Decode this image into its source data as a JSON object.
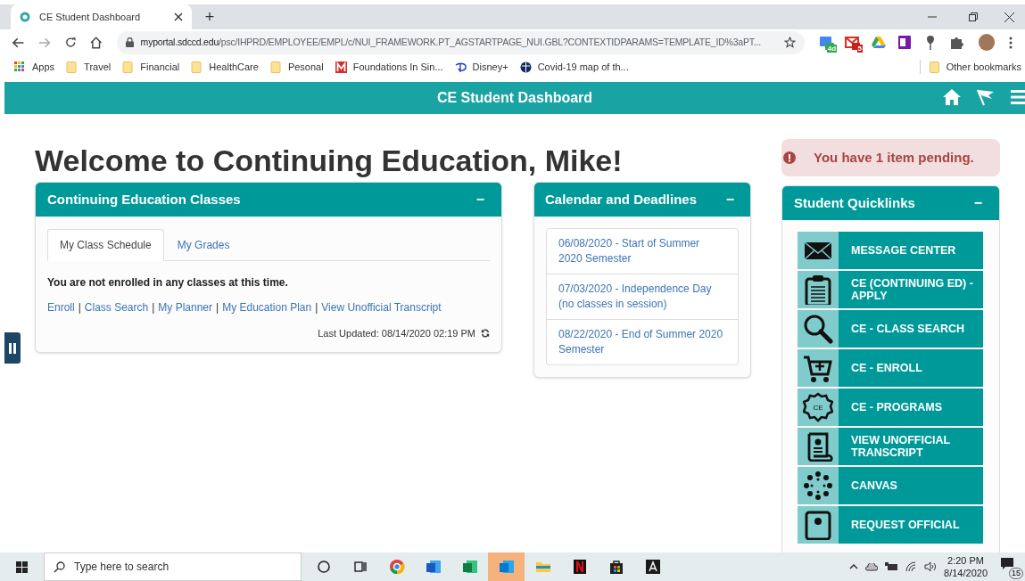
{
  "browser": {
    "tab_title": "CE Student Dashboard",
    "new_tab": "+",
    "url_host": "myportal.sdccd.edu",
    "url_path": "/psc/IHPRD/EMPLOYEE/EMPL/c/NUI_FRAMEWORK.PT_AGSTARTPAGE_NUI.GBL?CONTEXTIDPARAMS=TEMPLATE_ID%3aPT...",
    "extensions": [
      {
        "kind": "calendar",
        "badge": "4d"
      },
      {
        "kind": "mail",
        "badge": "5"
      },
      {
        "kind": "drive"
      },
      {
        "kind": "notebook"
      },
      {
        "kind": "pin"
      },
      {
        "kind": "puzzle"
      }
    ],
    "bookmarks": [
      {
        "kind": "apps",
        "label": "Apps"
      },
      {
        "kind": "folder",
        "label": "Travel"
      },
      {
        "kind": "folder",
        "label": "Financial"
      },
      {
        "kind": "folder",
        "label": "HealthCare"
      },
      {
        "kind": "folder",
        "label": "Pesonal"
      },
      {
        "kind": "m",
        "label": "Foundations In Sin..."
      },
      {
        "kind": "disney",
        "label": "Disney+"
      },
      {
        "kind": "globe",
        "label": "Covid-19 map of th..."
      }
    ],
    "other_bookmarks": "Other bookmarks"
  },
  "header": {
    "title": "CE Student Dashboard"
  },
  "welcome": "Welcome to Continuing Education, Mike!",
  "alert": "You have 1 item pending.",
  "classes": {
    "title": "Continuing Education Classes",
    "collapse": "−",
    "tabs": [
      {
        "label": "My Class Schedule",
        "selected": true
      },
      {
        "label": "My Grades",
        "selected": false
      }
    ],
    "message": "You are not enrolled in any classes at this time.",
    "separator": "|",
    "links": [
      "Enroll",
      "Class Search",
      "My Planner",
      "My Education Plan",
      "View Unofficial Transcript"
    ],
    "updated": "Last Updated: 08/14/2020 02:19 PM"
  },
  "calendar": {
    "title": "Calendar and Deadlines",
    "collapse": "−",
    "events": [
      "06/08/2020 - Start of Summer 2020 Semester",
      "07/03/2020 - Independence Day (no classes in session)",
      "08/22/2020 - End of Summer 2020 Semester"
    ]
  },
  "quicklinks": {
    "title": "Student Quicklinks",
    "collapse": "−",
    "items": [
      {
        "kind": "envelope",
        "label": "MESSAGE CENTER"
      },
      {
        "kind": "clipboard",
        "label": "CE (CONTINUING ED) - APPLY"
      },
      {
        "kind": "magnifier",
        "label": "CE - CLASS SEARCH"
      },
      {
        "kind": "cart",
        "label": "CE - ENROLL"
      },
      {
        "kind": "seal",
        "badge": "CE",
        "label": "CE - PROGRAMS"
      },
      {
        "kind": "scroll",
        "label": "VIEW UNOFFICIAL TRANSCRIPT"
      },
      {
        "kind": "canvas",
        "label": "CANVAS"
      },
      {
        "kind": "document",
        "label": "REQUEST OFFICIAL"
      }
    ]
  },
  "taskbar": {
    "search_placeholder": "Type here to search",
    "apps": [
      {
        "kind": "cortana",
        "selected": false
      },
      {
        "kind": "taskview",
        "selected": false
      },
      {
        "kind": "chrome",
        "selected": false
      },
      {
        "kind": "word",
        "selected": false
      },
      {
        "kind": "excel",
        "selected": false
      },
      {
        "kind": "outlook",
        "selected": true
      },
      {
        "kind": "explorer",
        "selected": false
      },
      {
        "kind": "netflix",
        "selected": false
      },
      {
        "kind": "store",
        "selected": false
      },
      {
        "kind": "acrobat",
        "selected": false
      }
    ],
    "time": "2:20 PM",
    "date": "8/14/2020",
    "notifications": "15"
  }
}
